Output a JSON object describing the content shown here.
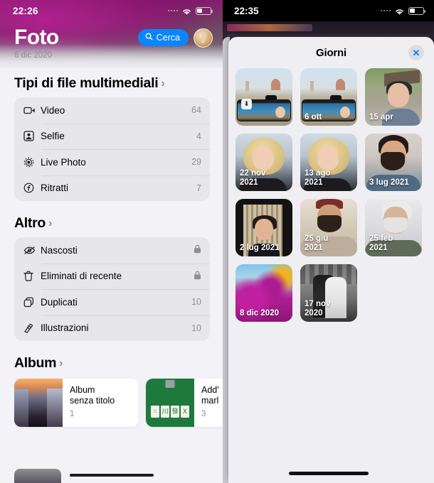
{
  "left_screen": {
    "status_bar": {
      "time": "22:26",
      "wifi_icon": "wifi-icon",
      "battery_icon": "battery-icon",
      "signal_icon": "signal-dots-icon"
    },
    "header": {
      "title": "Foto",
      "subtitle": "8 dic 2020",
      "search_label": "Cerca",
      "search_icon": "search-icon",
      "avatar": "user-avatar"
    },
    "sections": [
      {
        "id": "media-types",
        "title": "Tipi di file multimediali",
        "chevron": "›",
        "rows": [
          {
            "icon": "video-camera-icon",
            "glyph": "▭",
            "label": "Video",
            "value": "64"
          },
          {
            "icon": "selfie-icon",
            "glyph": "▣",
            "label": "Selfie",
            "value": "4"
          },
          {
            "icon": "live-photo-icon",
            "glyph": "◎",
            "label": "Live Photo",
            "value": "29"
          },
          {
            "icon": "portrait-icon",
            "glyph": "ƒ",
            "label": "Ritratti",
            "value": "7"
          }
        ]
      },
      {
        "id": "other",
        "title": "Altro",
        "chevron": "›",
        "rows": [
          {
            "icon": "eye-slash-icon",
            "glyph": "◉",
            "label": "Nascosti",
            "value": "🔒",
            "locked": true
          },
          {
            "icon": "trash-icon",
            "glyph": "Ὕ1",
            "label": "Eliminati di recente",
            "value": "🔒",
            "locked": true
          },
          {
            "icon": "duplicate-icon",
            "glyph": "⧉",
            "label": "Duplicati",
            "value": "10"
          },
          {
            "icon": "illustration-icon",
            "glyph": "✐",
            "label": "Illustrazioni",
            "value": "10"
          }
        ]
      }
    ],
    "albums_section": {
      "title": "Album",
      "chevron": "›",
      "items": [
        {
          "art": "th-city",
          "name_line1": "Album",
          "name_line2": "senza titolo",
          "count": "1"
        },
        {
          "art": "th-mahjong",
          "name_line1": "Add'",
          "name_line2": "marl",
          "count": "3"
        }
      ]
    }
  },
  "right_screen": {
    "status_bar": {
      "time": "22:35",
      "wifi_icon": "wifi-icon",
      "battery_icon": "battery-icon",
      "signal_icon": "signal-dots-icon"
    },
    "sheet": {
      "title": "Giorni",
      "close_icon": "close-x-icon",
      "close_label": "✕",
      "tiles": [
        {
          "label": "",
          "art": "art-florence",
          "badge": "⬇",
          "has_badge": true
        },
        {
          "label": "6 ott",
          "art": "art-florence",
          "has_badge": false
        },
        {
          "label": "15 apr",
          "art": "art-portrait1",
          "has_badge": false
        },
        {
          "label": "22 nov\n2021",
          "art": "art-blonde",
          "has_badge": false
        },
        {
          "label": "13 ago\n2021",
          "art": "art-blonde",
          "has_badge": false
        },
        {
          "label": "3 lug 2021",
          "art": "art-beard",
          "has_badge": false
        },
        {
          "label": "2 lug 2021",
          "art": "art-dark-girl",
          "has_badge": false
        },
        {
          "label": "25 giu\n2021",
          "art": "art-beard2",
          "has_badge": false
        },
        {
          "label": "25 feb\n2021",
          "art": "art-white",
          "has_badge": false
        },
        {
          "label": "8 dic 2020",
          "art": "art-flowers",
          "has_badge": false
        },
        {
          "label": "17 nov\n2020",
          "art": "art-bw",
          "has_badge": false
        }
      ]
    }
  },
  "colors": {
    "accent_blue": "#0a84ff",
    "sheet_bg": "#eeeef3",
    "page_bg": "#f2f2f7",
    "card_bg": "#e6e6eb",
    "secondary_text": "#8e8e93"
  }
}
